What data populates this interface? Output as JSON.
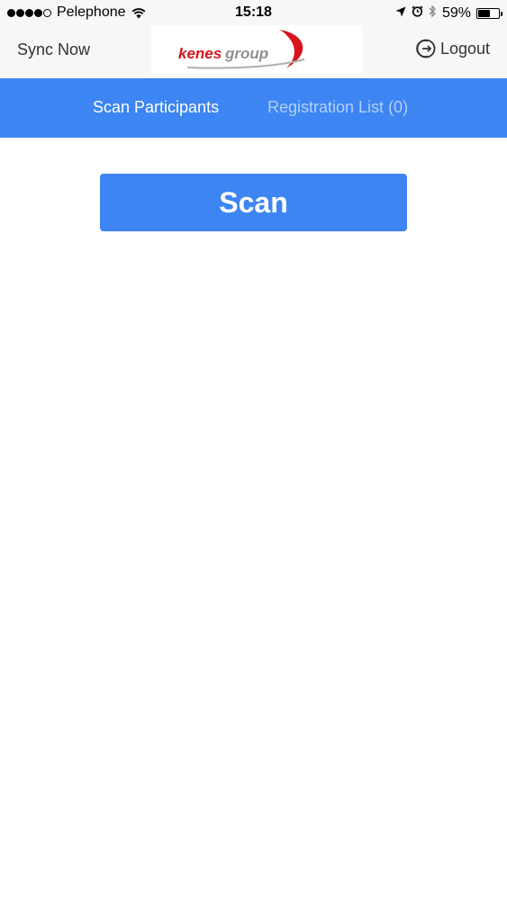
{
  "status_bar": {
    "carrier": "Pelephone",
    "time": "15:18",
    "battery_percent": "59%",
    "battery_level": 0.59,
    "signal_bars": 4,
    "signal_max": 5
  },
  "header": {
    "sync_label": "Sync Now",
    "logo_text": "kenesgroup",
    "logout_label": "Logout"
  },
  "tabs": [
    {
      "label": "Scan Participants",
      "active": true
    },
    {
      "label": "Registration List",
      "count": "(0)",
      "active": false
    }
  ],
  "main": {
    "scan_label": "Scan"
  },
  "colors": {
    "accent": "#3c85f2",
    "inactive_tab": "#b4cff8",
    "logo_red": "#d7141e"
  }
}
